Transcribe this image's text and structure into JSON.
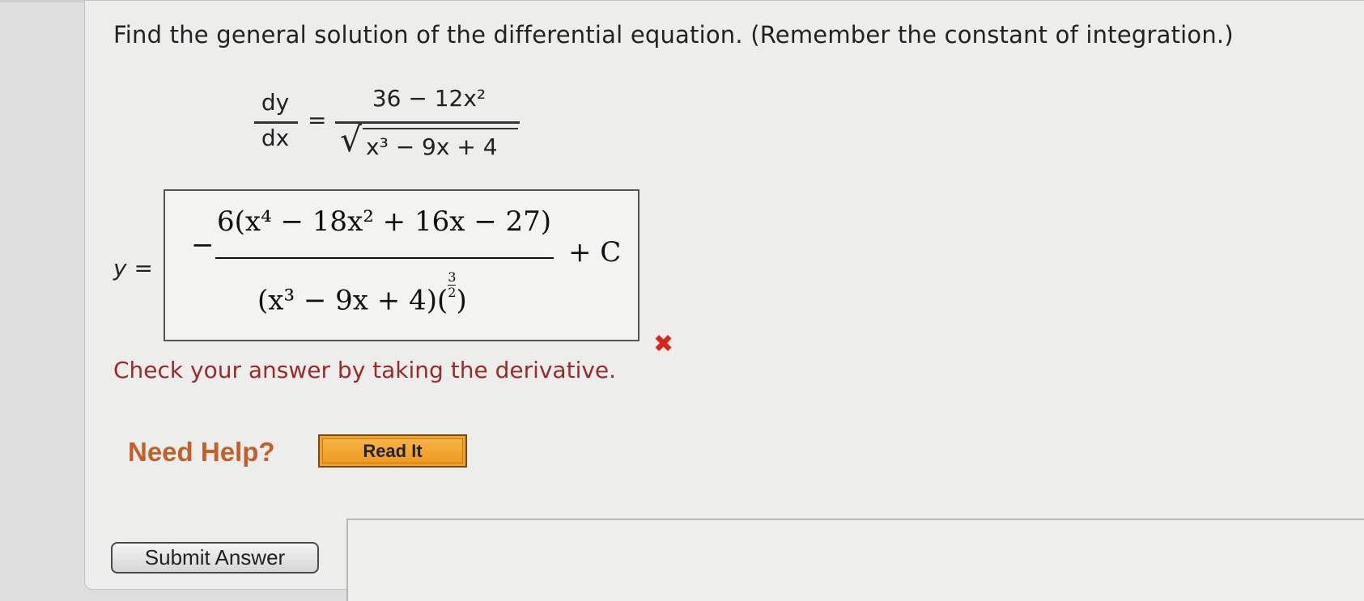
{
  "question": {
    "prompt": "Find the general solution of the differential equation. (Remember the constant of integration.)",
    "equation": {
      "lhs_numerator": "dy",
      "lhs_denominator": "dx",
      "equals": "=",
      "rhs_numerator": "36 − 12x²",
      "rhs_denominator": "x³ − 9x + 4"
    }
  },
  "answer": {
    "label": "y =",
    "leading_sign": "−",
    "numerator": "6(x⁴ − 18x² + 16x − 27)",
    "denominator_base": "(x³ − 9x + 4)",
    "exponent_numerator": "3",
    "exponent_denominator": "2",
    "constant": "+ C",
    "status": "incorrect",
    "status_color": "#d9261c"
  },
  "feedback": {
    "message": "Check your answer by taking the derivative."
  },
  "help": {
    "label": "Need Help?",
    "read_it_label": "Read It"
  },
  "actions": {
    "submit_label": "Submit Answer"
  }
}
